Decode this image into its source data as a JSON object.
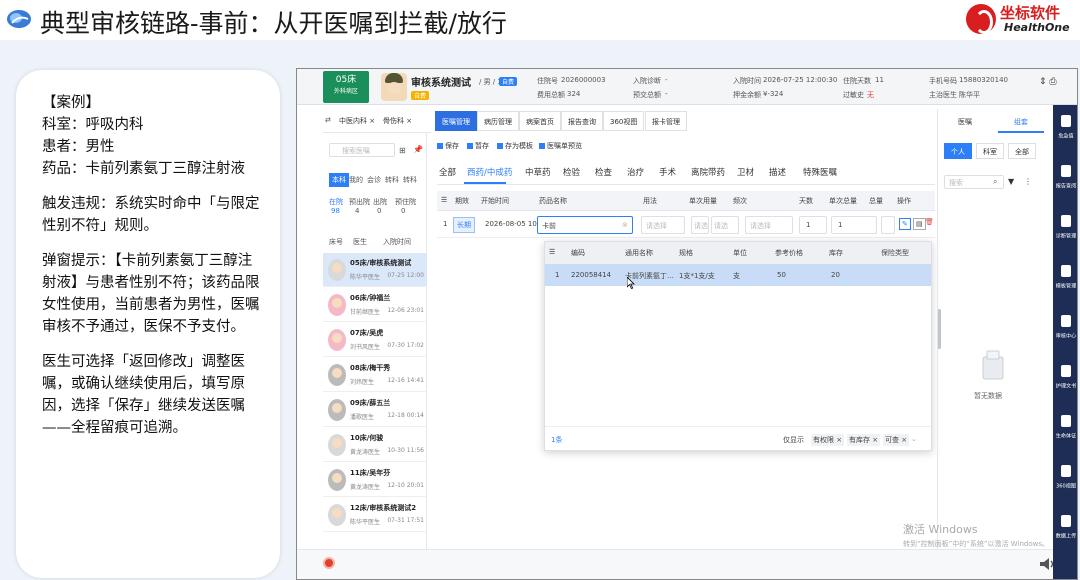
{
  "slide": {
    "title": "典型审核链路-事前：从开医嘱到拦截/放行",
    "brand_cn": "坐标软件",
    "brand_en": "HealthOne"
  },
  "case": {
    "heading": "【案例】",
    "dept": "科室：呼吸内科",
    "patient": "患者：男性",
    "drug": "药品：卡前列素氨丁三醇注射液",
    "trigger": "触发违规：系统实时命中「与限定性别不符」规则。",
    "popup": "弹窗提示：【卡前列素氨丁三醇注射液】与患者性别不符；该药品限女性使用，当前患者为男性，医嘱审核不予通过，医保不予支付。",
    "action": "医生可选择「返回修改」调整医嘱，或确认继续使用后，填写原因，选择「保存」继续发送医嘱",
    "trace": "——全程留痕可追溯。"
  },
  "ehr": {
    "bed_badge": "05床",
    "bed_ward": "外科病区",
    "patient_name": "审核系统测试",
    "patient_meta": "/ 男 / 30岁",
    "tag_self": "自费",
    "tag_yellow": "自费",
    "hosp_no_label": "住院号",
    "hosp_no": "2026000003",
    "fee_label": "费用总额",
    "fee": "324",
    "admit_diag_label": "入院诊断",
    "admit_diag": "-",
    "pre_pay_label": "预交总额",
    "pre_pay": "-",
    "admit_time_label": "入院时间",
    "admit_time": "2026-07-25 12:00:30",
    "deposit_label": "押金余额",
    "deposit": "¥-324",
    "days_label": "住院天数",
    "days": "11",
    "allergy_label": "过敏史",
    "allergy": "无",
    "phone_label": "手机号码",
    "phone": "15880320140",
    "doctor_label": "主治医生",
    "doctor": "陈华平",
    "left_tabs": [
      "中医内科 ×",
      "骨伤科 ×"
    ],
    "left_search": "搜索医嘱",
    "patient_filters": [
      "本科",
      "我的",
      "会诊",
      "转科",
      "转科"
    ],
    "counts_labels": [
      "在院",
      "预出院",
      "出院",
      "预住院"
    ],
    "counts": [
      "98",
      "4",
      "0",
      "0"
    ],
    "sort": [
      "床号",
      "医生",
      "入院时间"
    ],
    "patients": [
      {
        "name": "05床/审核系统测试",
        "doc": "陈华平医生",
        "time": "07-25 12:00"
      },
      {
        "name": "06床/钟福兰",
        "doc": "甘前继医生",
        "time": "12-06 23:01"
      },
      {
        "name": "07床/吴虎",
        "doc": "刘书风医生",
        "time": "07-30 17:02"
      },
      {
        "name": "08床/梅干秀",
        "doc": "刘炜医生",
        "time": "12-16 14:41"
      },
      {
        "name": "09床/薛五兰",
        "doc": "潘歌医生",
        "time": "12-18 00:14"
      },
      {
        "name": "10床/何骏",
        "doc": "黄龙涛医生",
        "time": "10-30 11:56"
      },
      {
        "name": "11床/吴年芬",
        "doc": "黄龙涛医生",
        "time": "12-10 20:01"
      },
      {
        "name": "12床/审核系统测试2",
        "doc": "陈华平医生",
        "time": "07-31 17:51"
      }
    ],
    "top_tabs": [
      "医嘱管理",
      "病历管理",
      "病案首页",
      "报告查询",
      "360视图",
      "报卡管理"
    ],
    "tools": [
      "保存",
      "暂存",
      "存为模板",
      "医嘱单预览"
    ],
    "cats": [
      "全部",
      "西药/中成药",
      "中草药",
      "检验",
      "检查",
      "治疗",
      "手术",
      "离院带药",
      "卫材",
      "描述",
      "特殊医嘱"
    ],
    "grid_head": [
      "期效",
      "开始时间",
      "药品名称",
      "用法",
      "单次用量",
      "频次",
      "天数",
      "单次总量",
      "总量",
      "操作"
    ],
    "row_no": "1",
    "row_type": "长期",
    "row_time": "2026-08-05 10",
    "row_drug": "卡前",
    "row_days": "1",
    "row_total": "1",
    "ph_select": "请选择",
    "ph_choose": "请选",
    "pop_head": [
      "编码",
      "通用名称",
      "规格",
      "单位",
      "参考价格",
      "库存",
      "保险类型"
    ],
    "pop_row": [
      "1",
      "220058414",
      "卡前列素氨丁...",
      "1支*1支/支",
      "支",
      "50",
      "20",
      ""
    ],
    "pop_count": "1条",
    "pop_filters": [
      "仅显示",
      "有权限 ×",
      "有库存 ×",
      "可查 ×"
    ],
    "right_tabs": [
      "医嘱",
      "组套"
    ],
    "right_segs": [
      "个人",
      "科室",
      "全部"
    ],
    "right_search": "搜索",
    "empty": "暂无数据",
    "sidebar": [
      "危急值",
      "报告查阅",
      "诊断管理",
      "模板管理",
      "审核中心",
      "护理文书",
      "生命体征",
      "360视图",
      "数据上传"
    ],
    "watermark1": "激活 Windows",
    "watermark2": "转到“控制面板”中的“系统”以激活 Windows。"
  }
}
